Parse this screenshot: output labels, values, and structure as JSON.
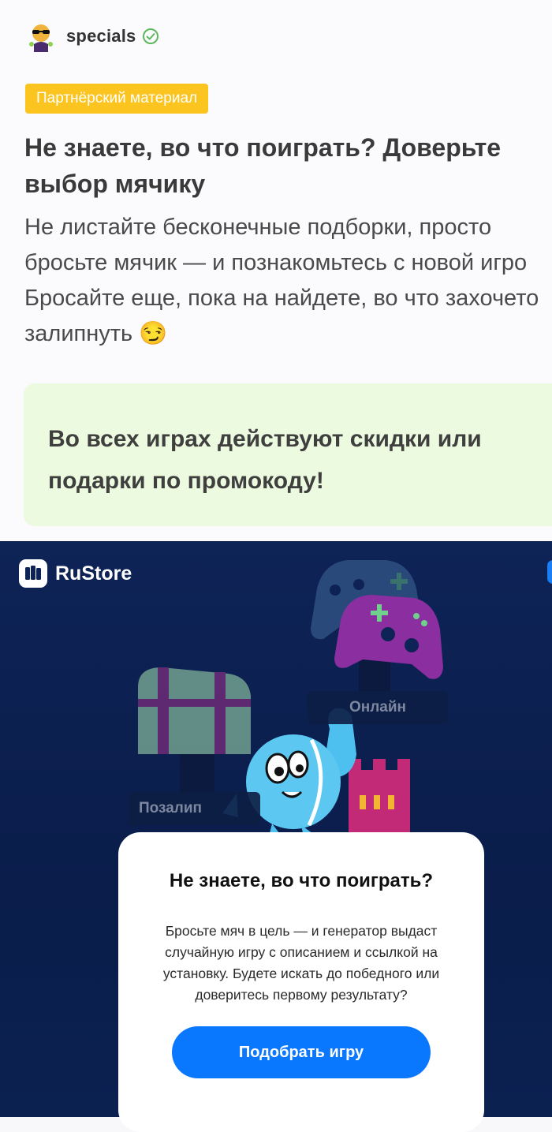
{
  "author": {
    "name": "specials",
    "avatar_icon": "sunglasses-character-avatar",
    "verified_icon": "verified-check-icon"
  },
  "badge": {
    "label": "Партнёрский материал"
  },
  "article": {
    "title": "Не знаете, во что поиграть? Доверьте выбор мячику",
    "lead_lines": [
      "Не листайте бесконечные подборки, просто",
      "бросьте мячик — и познакомьтесь с новой игро",
      "Бросайте еще, пока на найдете, во что захочето",
      "залипнуть 😏"
    ]
  },
  "promo": {
    "text": "Во всех играх действуют скидки или подарки по промокоду!"
  },
  "banner": {
    "brand": "RuStore",
    "labels": {
      "online": "Онлайн",
      "zalip": "Позалип"
    },
    "modal": {
      "title": "Не знаете, во что поиграть?",
      "body": "Бросьте мяч в цель — и генератор выдаст случайную игру с описанием и ссылкой на установку. Будете искать до победного или доверитесь первому результату?",
      "button_label": "Подобрать игру"
    },
    "colors": {
      "accent": "#0a77ff",
      "badge": "#fbc41e",
      "promo_bg": "#ecfbdf",
      "banner_bg": "#0e2356"
    }
  }
}
